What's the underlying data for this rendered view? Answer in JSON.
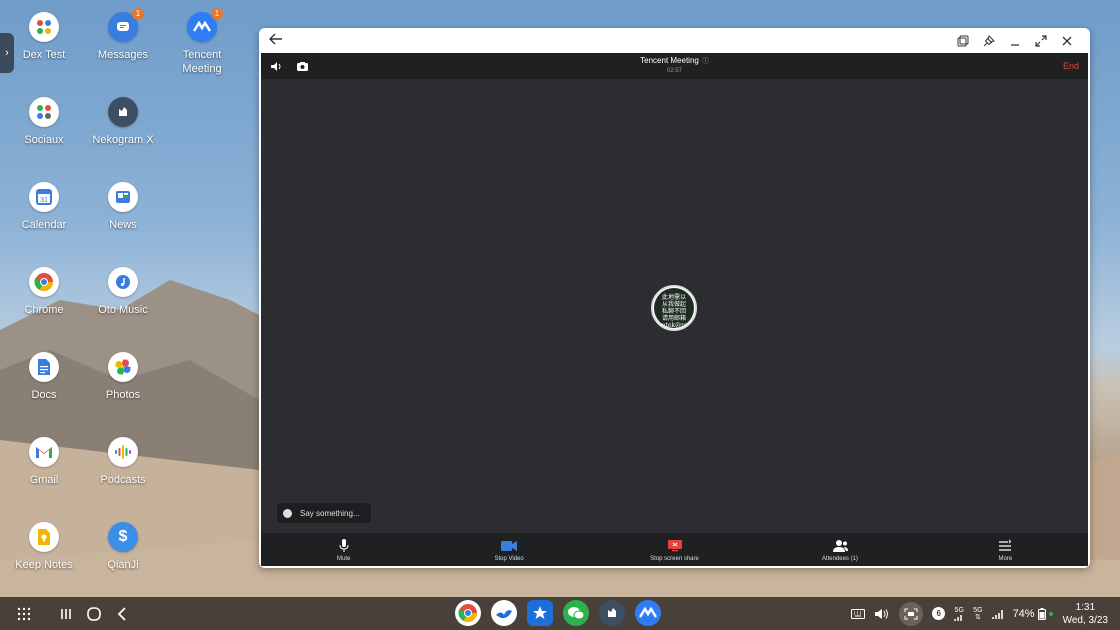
{
  "desktop": {
    "icons": [
      {
        "label": "Dex Test",
        "icon": "folder-grid-icon",
        "badge": ""
      },
      {
        "label": "Messages",
        "icon": "messages-icon",
        "badge": "1"
      },
      {
        "label": "Tencent Meeting",
        "icon": "tencent-meeting-icon",
        "badge": "1"
      },
      {
        "label": "Sociaux",
        "icon": "folder-grid-icon",
        "badge": ""
      },
      {
        "label": "Nekogram X",
        "icon": "nekogram-icon",
        "badge": ""
      },
      {
        "label": "Calendar",
        "icon": "calendar-icon",
        "badge": "",
        "calendar_day": "31"
      },
      {
        "label": "News",
        "icon": "news-icon",
        "badge": ""
      },
      {
        "label": "Chrome",
        "icon": "chrome-icon",
        "badge": ""
      },
      {
        "label": "Oto Music",
        "icon": "music-icon",
        "badge": ""
      },
      {
        "label": "Docs",
        "icon": "docs-icon",
        "badge": ""
      },
      {
        "label": "Photos",
        "icon": "photos-icon",
        "badge": ""
      },
      {
        "label": "Gmail",
        "icon": "gmail-icon",
        "badge": ""
      },
      {
        "label": "Podcasts",
        "icon": "podcasts-icon",
        "badge": ""
      },
      {
        "label": "Keep Notes",
        "icon": "keep-icon",
        "badge": ""
      },
      {
        "label": "QianJi",
        "icon": "qianji-icon",
        "badge": ""
      }
    ]
  },
  "meeting": {
    "title": "Tencent Meeting",
    "timer": "02:57",
    "end_label": "End",
    "chat_placeholder": "Say something...",
    "avatar_text": "此地需以\n从我做起\n私聊不回\n请用邮箱\nhimtek@pu...",
    "toolbar": [
      {
        "label": "Mute",
        "icon": "microphone-icon"
      },
      {
        "label": "Stop Video",
        "icon": "video-camera-icon"
      },
      {
        "label": "Stop screen share",
        "icon": "screen-share-icon"
      },
      {
        "label": "Attendees (1)",
        "icon": "attendees-icon"
      },
      {
        "label": "More",
        "icon": "more-menu-icon"
      }
    ]
  },
  "taskbar": {
    "apps": [
      "chrome-icon",
      "bird-app-icon",
      "star-app-icon",
      "wechat-icon",
      "nekogram-icon",
      "tencent-meeting-icon"
    ],
    "notification_count": "6",
    "network_1": "5G",
    "network_2": "5G",
    "battery": "74%",
    "time": "1:31",
    "date": "Wed, 3/23"
  },
  "colors": {
    "end": "#e5443b",
    "meeting_bg": "#2b2d30",
    "accent_blue": "#3a7de0",
    "taskbar": "#4a403a"
  }
}
